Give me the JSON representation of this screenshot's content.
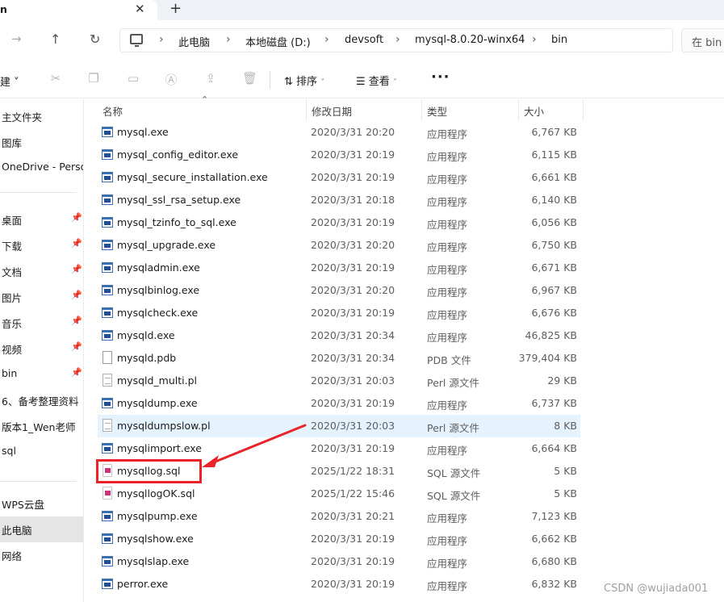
{
  "tab": {
    "title": "n",
    "close": "✕",
    "new": "+"
  },
  "nav": {
    "breadcrumbs": [
      "此电脑",
      "本地磁盘 (D:)",
      "devsoft",
      "mysql-8.0.20-winx64",
      "bin"
    ],
    "search_placeholder": "在 bin"
  },
  "toolbar": {
    "new_label": "建 ˅",
    "sort_label": "排序",
    "view_label": "查看",
    "more_label": "···"
  },
  "sidebar": {
    "items": [
      {
        "label": "主文件夹",
        "pinned": false
      },
      {
        "label": "图库",
        "pinned": false
      },
      {
        "label": "OneDrive - Perso",
        "pinned": false
      },
      {
        "label": "桌面",
        "pinned": true
      },
      {
        "label": "下载",
        "pinned": true
      },
      {
        "label": "文档",
        "pinned": true
      },
      {
        "label": "图片",
        "pinned": true
      },
      {
        "label": "音乐",
        "pinned": true
      },
      {
        "label": "视频",
        "pinned": true
      },
      {
        "label": "bin",
        "pinned": true
      },
      {
        "label": "6、备考整理资料",
        "pinned": false
      },
      {
        "label": "版本1_Wen老师",
        "pinned": false
      },
      {
        "label": "sql",
        "pinned": false
      },
      {
        "label": "WPS云盘",
        "pinned": false
      },
      {
        "label": "此电脑",
        "pinned": false,
        "selected": true
      },
      {
        "label": "网络",
        "pinned": false
      }
    ]
  },
  "columns": {
    "name": "名称",
    "date": "修改日期",
    "type": "类型",
    "size": "大小"
  },
  "files": [
    {
      "name": "mysql.exe",
      "date": "2020/3/31 20:20",
      "type": "应用程序",
      "size": "6,767 KB",
      "icon": "exe"
    },
    {
      "name": "mysql_config_editor.exe",
      "date": "2020/3/31 20:19",
      "type": "应用程序",
      "size": "6,115 KB",
      "icon": "exe"
    },
    {
      "name": "mysql_secure_installation.exe",
      "date": "2020/3/31 20:19",
      "type": "应用程序",
      "size": "6,661 KB",
      "icon": "exe"
    },
    {
      "name": "mysql_ssl_rsa_setup.exe",
      "date": "2020/3/31 20:18",
      "type": "应用程序",
      "size": "6,140 KB",
      "icon": "exe"
    },
    {
      "name": "mysql_tzinfo_to_sql.exe",
      "date": "2020/3/31 20:19",
      "type": "应用程序",
      "size": "6,056 KB",
      "icon": "exe"
    },
    {
      "name": "mysql_upgrade.exe",
      "date": "2020/3/31 20:20",
      "type": "应用程序",
      "size": "6,750 KB",
      "icon": "exe"
    },
    {
      "name": "mysqladmin.exe",
      "date": "2020/3/31 20:19",
      "type": "应用程序",
      "size": "6,671 KB",
      "icon": "exe"
    },
    {
      "name": "mysqlbinlog.exe",
      "date": "2020/3/31 20:20",
      "type": "应用程序",
      "size": "6,967 KB",
      "icon": "exe"
    },
    {
      "name": "mysqlcheck.exe",
      "date": "2020/3/31 20:19",
      "type": "应用程序",
      "size": "6,676 KB",
      "icon": "exe"
    },
    {
      "name": "mysqld.exe",
      "date": "2020/3/31 20:34",
      "type": "应用程序",
      "size": "46,825 KB",
      "icon": "exe"
    },
    {
      "name": "mysqld.pdb",
      "date": "2020/3/31 20:34",
      "type": "PDB 文件",
      "size": "379,404 KB",
      "icon": "doc"
    },
    {
      "name": "mysqld_multi.pl",
      "date": "2020/3/31 20:03",
      "type": "Perl 源文件",
      "size": "29 KB",
      "icon": "txt"
    },
    {
      "name": "mysqldump.exe",
      "date": "2020/3/31 20:19",
      "type": "应用程序",
      "size": "6,737 KB",
      "icon": "exe"
    },
    {
      "name": "mysqldumpslow.pl",
      "date": "2020/3/31 20:03",
      "type": "Perl 源文件",
      "size": "8 KB",
      "icon": "txt",
      "hover": true
    },
    {
      "name": "mysqlimport.exe",
      "date": "2020/3/31 20:19",
      "type": "应用程序",
      "size": "6,664 KB",
      "icon": "exe"
    },
    {
      "name": "mysqllog.sql",
      "date": "2025/1/22 18:31",
      "type": "SQL 源文件",
      "size": "5 KB",
      "icon": "sql"
    },
    {
      "name": "mysqllogOK.sql",
      "date": "2025/1/22 15:46",
      "type": "SQL 源文件",
      "size": "5 KB",
      "icon": "sql"
    },
    {
      "name": "mysqlpump.exe",
      "date": "2020/3/31 20:21",
      "type": "应用程序",
      "size": "7,123 KB",
      "icon": "exe"
    },
    {
      "name": "mysqlshow.exe",
      "date": "2020/3/31 20:19",
      "type": "应用程序",
      "size": "6,662 KB",
      "icon": "exe"
    },
    {
      "name": "mysqlslap.exe",
      "date": "2020/3/31 20:19",
      "type": "应用程序",
      "size": "6,680 KB",
      "icon": "exe"
    },
    {
      "name": "perror.exe",
      "date": "2020/3/31 20:19",
      "type": "应用程序",
      "size": "6,832 KB",
      "icon": "exe"
    }
  ],
  "annotation": {
    "color": "#e8242a"
  },
  "watermark": "CSDN @wujiada001"
}
